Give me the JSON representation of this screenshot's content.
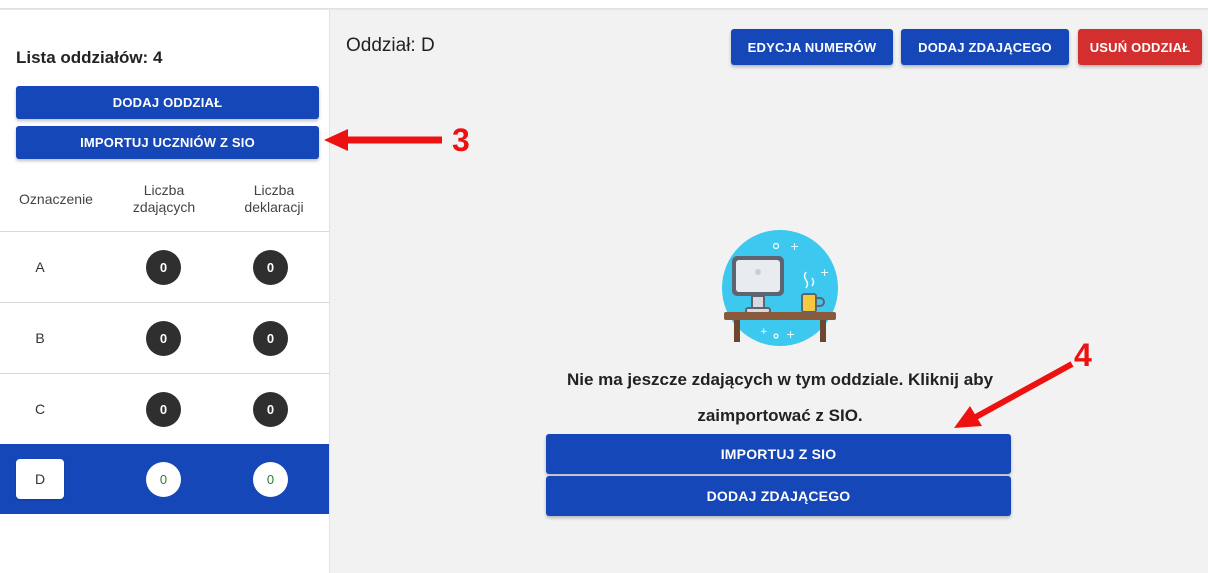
{
  "sidebar": {
    "title": "Lista oddziałów: 4",
    "add_class_label": "DODAJ ODDZIAŁ",
    "import_students_label": "IMPORTUJ UCZNIÓW Z SIO",
    "columns": {
      "designation": "Oznaczenie",
      "students_count_line1": "Liczba",
      "students_count_line2": "zdających",
      "declarations_count_line1": "Liczba",
      "declarations_count_line2": "deklaracji"
    },
    "rows": [
      {
        "label": "A",
        "students": "0",
        "declarations": "0"
      },
      {
        "label": "B",
        "students": "0",
        "declarations": "0"
      },
      {
        "label": "C",
        "students": "0",
        "declarations": "0"
      },
      {
        "label": "D",
        "students": "0",
        "declarations": "0",
        "selected": true
      }
    ]
  },
  "main": {
    "title": "Oddział: D",
    "edit_numbers_label": "EDYCJA NUMERÓW",
    "add_student_label": "DODAJ ZDAJĄCEGO",
    "delete_class_label": "USUŃ ODDZIAŁ",
    "empty_message_line1": "Nie ma jeszcze zdających w tym oddziale. Kliknij aby",
    "empty_message_line2": "zaimportować z SIO.",
    "import_sio_label": "IMPORTUJ Z SIO",
    "add_student_bottom_label": "DODAJ ZDAJĄCEGO"
  },
  "annotations": {
    "marker_3": "3",
    "marker_4": "4"
  },
  "colors": {
    "primary": "#1547b8",
    "danger": "#d32f2f",
    "annotation": "#ee1111"
  }
}
